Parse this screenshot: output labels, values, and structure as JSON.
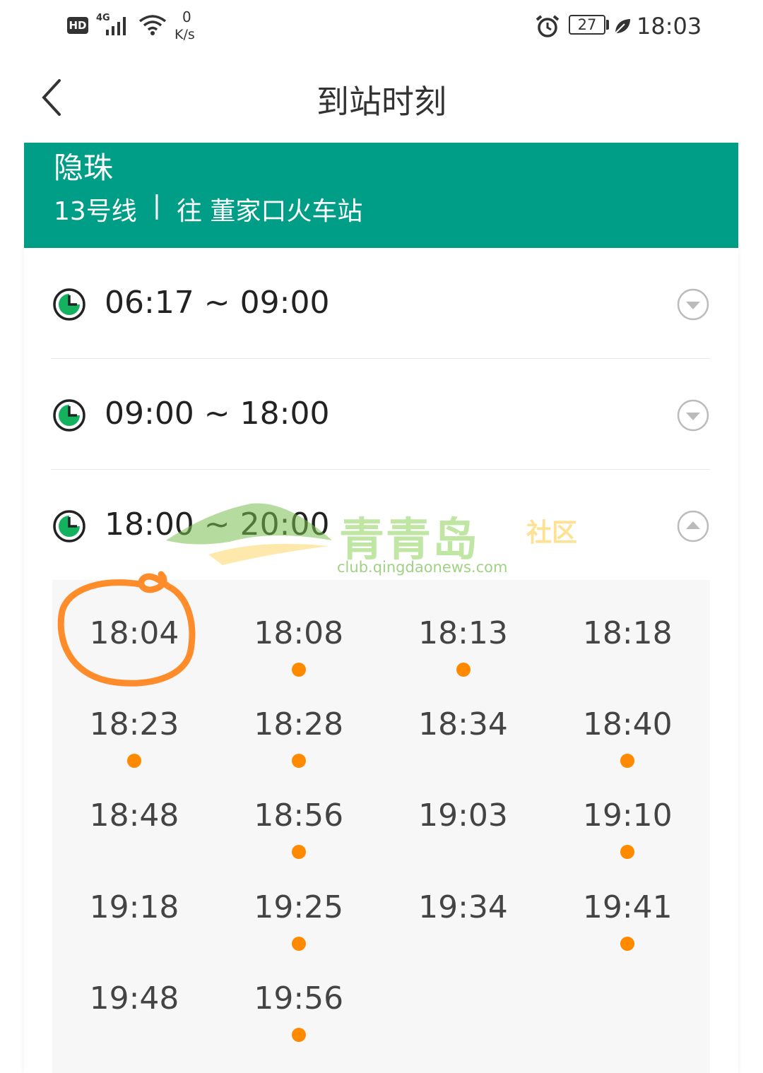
{
  "status_bar": {
    "hd": "HD",
    "network": "4G",
    "speed_value": "0",
    "speed_unit": "K/s",
    "battery": "27",
    "time": "18:03"
  },
  "header": {
    "title": "到站时刻"
  },
  "line_card": {
    "station": "隐珠",
    "line": "13号线",
    "separator": "|",
    "direction": "往 董家口火车站"
  },
  "periods": [
    {
      "label": "06:17 ~ 09:00",
      "expanded": false
    },
    {
      "label": "09:00 ~ 18:00",
      "expanded": false
    },
    {
      "label": "18:00 ~ 20:00",
      "expanded": true
    }
  ],
  "times": [
    {
      "time": "18:04",
      "dot": false
    },
    {
      "time": "18:08",
      "dot": true
    },
    {
      "time": "18:13",
      "dot": true
    },
    {
      "time": "18:18",
      "dot": false
    },
    {
      "time": "18:23",
      "dot": true
    },
    {
      "time": "18:28",
      "dot": true
    },
    {
      "time": "18:34",
      "dot": false
    },
    {
      "time": "18:40",
      "dot": true
    },
    {
      "time": "18:48",
      "dot": false
    },
    {
      "time": "18:56",
      "dot": true
    },
    {
      "time": "19:03",
      "dot": false
    },
    {
      "time": "19:10",
      "dot": true
    },
    {
      "time": "19:18",
      "dot": false
    },
    {
      "time": "19:25",
      "dot": true
    },
    {
      "time": "19:34",
      "dot": false
    },
    {
      "time": "19:41",
      "dot": true
    },
    {
      "time": "19:48",
      "dot": false
    },
    {
      "time": "19:56",
      "dot": true
    }
  ],
  "watermark": {
    "name": "青青岛",
    "suffix": "社区",
    "url": "club.qingdaonews.com"
  },
  "colors": {
    "brand_green": "#009e86",
    "dot_orange": "#ff8a00",
    "annotation_orange": "#ff8c2a"
  }
}
